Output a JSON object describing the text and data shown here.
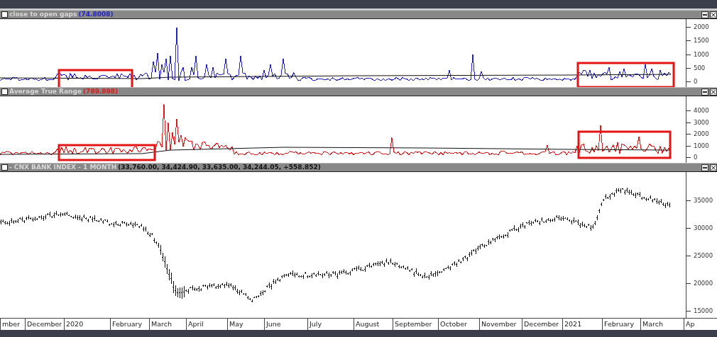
{
  "panes": [
    {
      "kind": "gaps",
      "title": "close to open gaps",
      "value": "(74.8008)",
      "color": "#2222cc",
      "y_labels": [
        "2000",
        "1500",
        "1000",
        "500",
        "0"
      ]
    },
    {
      "kind": "atr",
      "title": "Average True Range",
      "value": "(789.898)",
      "color": "#e01818",
      "y_labels": [
        "4000",
        "3000",
        "2000",
        "1000",
        "0"
      ]
    },
    {
      "kind": "price",
      "title": "- CNX BANK INDEX - 1 MONTH",
      "value": "(33,760.00, 34,424.90, 33,635.00, 34,244.05, +558.852)",
      "color": "#111111",
      "y_labels": [
        "35000",
        "30000",
        "25000",
        "20000",
        "15000"
      ]
    }
  ],
  "x_axis": [
    "mber",
    "December",
    "2020",
    "February",
    "March",
    "April",
    "May",
    "June",
    "July",
    "August",
    "September",
    "October",
    "November",
    "December",
    "2021",
    "February",
    "March",
    "Ap"
  ]
}
